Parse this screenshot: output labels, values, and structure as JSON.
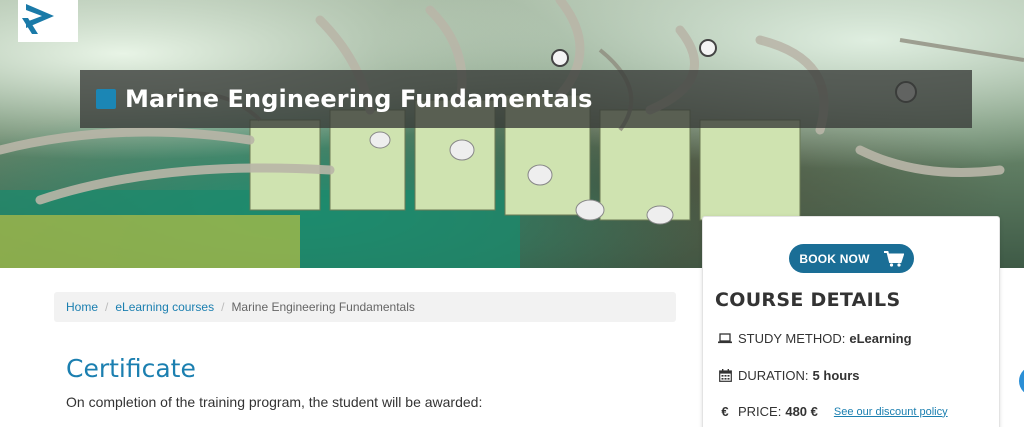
{
  "hero": {
    "title": "Marine Engineering Fundamentals"
  },
  "breadcrumb": {
    "items": [
      {
        "label": "Home",
        "link": true
      },
      {
        "label": "eLearning courses",
        "link": true
      },
      {
        "label": "Marine Engineering Fundamentals",
        "link": false
      }
    ],
    "separator": "/"
  },
  "main": {
    "heading": "Certificate",
    "text": "On completion of the training program, the student will be awarded:"
  },
  "course_details": {
    "book_label": "BOOK NOW",
    "title": "COURSE DETAILS",
    "study_method": {
      "label": "STUDY METHOD:",
      "value": "eLearning",
      "icon": "laptop-icon"
    },
    "duration": {
      "label": "DURATION:",
      "value": "5 hours",
      "icon": "calendar-icon"
    },
    "price": {
      "label": "PRICE:",
      "value": "480 €",
      "icon": "euro-icon",
      "symbol": "€",
      "link": "See our discount policy"
    }
  },
  "colors": {
    "accent": "#1b7fb0",
    "button": "#1a6e96",
    "title_square": "#1b86b5"
  }
}
